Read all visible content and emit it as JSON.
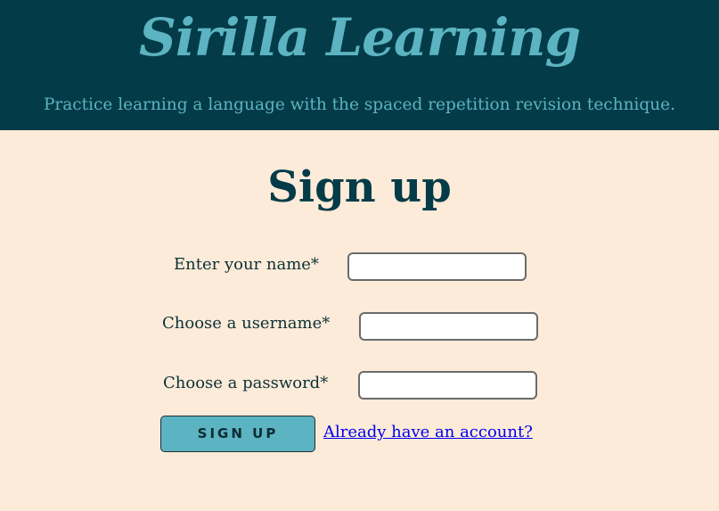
{
  "header": {
    "brand": "Sirilla Learning",
    "tagline": "Practice learning a language with the spaced repetition revision technique."
  },
  "page": {
    "title": "Sign up"
  },
  "form": {
    "name_label": "Enter your name*",
    "name_value": "",
    "username_label": "Choose a username*",
    "username_value": "",
    "password_label": "Choose a password*",
    "password_value": "",
    "submit_label": "SIGN UP",
    "login_link": "Already have an account?"
  },
  "colors": {
    "header_bg": "#043b48",
    "brand_teal": "#5cb3c1",
    "page_bg": "#fcebd8",
    "title_color": "#043b48",
    "link": "#0000ee"
  }
}
